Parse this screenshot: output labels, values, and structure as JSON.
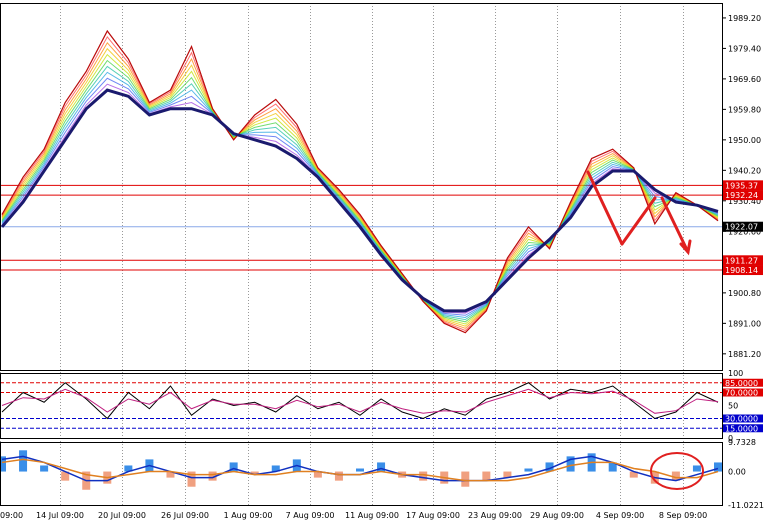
{
  "chart_data": [
    {
      "type": "line",
      "panel": "price",
      "ylim": [
        1876.0,
        1994.0
      ],
      "y_ticks": [
        "1989.20",
        "1979.40",
        "1969.60",
        "1959.80",
        "1950.00",
        "1940.20",
        "1930.40",
        "1920.60",
        "1900.80",
        "1891.00",
        "1881.20"
      ],
      "price_line_label": "1922.07",
      "price_line_value": 1922.07,
      "levels": [
        {
          "label": "1935.37",
          "value": 1935.37
        },
        {
          "label": "1932.24",
          "value": 1932.24
        },
        {
          "label": "1911.27",
          "value": 1911.27
        },
        {
          "label": "1908.14",
          "value": 1908.14
        }
      ],
      "x_labels": [
        "09:00",
        "14 Jul 09:00",
        "20 Jul 09:00",
        "26 Jul 09:00",
        "1 Aug 09:00",
        "7 Aug 09:00",
        "11 Aug 09:00",
        "17 Aug 09:00",
        "23 Aug 09:00",
        "29 Aug 09:00",
        "4 Sep 09:00",
        "8 Sep 09:00"
      ],
      "series": [
        {
          "values": [
            1926,
            1938,
            1947,
            1962,
            1972,
            1985,
            1976,
            1962,
            1966,
            1980,
            1960,
            1950,
            1958,
            1963,
            1955,
            1941,
            1934,
            1926,
            1916,
            1907,
            1898,
            1891,
            1888,
            1895,
            1912,
            1922,
            1915,
            1930,
            1944,
            1947,
            1941,
            1923,
            1933,
            1929,
            1924
          ]
        },
        {
          "values": [
            1922,
            1930,
            1940,
            1950,
            1960,
            1966,
            1964,
            1958,
            1960,
            1960,
            1958,
            1952,
            1950,
            1948,
            1944,
            1938,
            1930,
            1922,
            1913,
            1905,
            1899,
            1895,
            1895,
            1898,
            1905,
            1912,
            1918,
            1925,
            1935,
            1940,
            1940,
            1934,
            1930,
            1929,
            1927
          ]
        }
      ]
    },
    {
      "type": "line",
      "panel": "oscillator",
      "ylim": [
        0,
        100
      ],
      "y_ticks": [
        "100",
        "50",
        "0"
      ],
      "levels": [
        {
          "label": "85.0000",
          "value": 85
        },
        {
          "label": "70.0000",
          "value": 70
        },
        {
          "label": "30.0000",
          "value": 30
        },
        {
          "label": "15.0000",
          "value": 15
        }
      ],
      "series": [
        {
          "values": [
            40,
            70,
            55,
            85,
            60,
            30,
            70,
            45,
            80,
            35,
            60,
            50,
            55,
            40,
            65,
            45,
            55,
            35,
            60,
            40,
            30,
            45,
            35,
            60,
            70,
            85,
            60,
            75,
            70,
            80,
            55,
            30,
            40,
            70,
            55
          ]
        },
        {
          "values": [
            50,
            62,
            60,
            75,
            62,
            40,
            60,
            52,
            70,
            45,
            58,
            52,
            52,
            45,
            58,
            48,
            52,
            40,
            55,
            45,
            38,
            42,
            40,
            55,
            65,
            75,
            62,
            70,
            68,
            72,
            58,
            38,
            42,
            60,
            56
          ]
        }
      ]
    },
    {
      "type": "bar",
      "panel": "histogram",
      "ylim": [
        -11.0221,
        9.7328
      ],
      "y_ticks": [
        "9.7328",
        "0.00",
        "-11.0221"
      ],
      "values": [
        5,
        7,
        2,
        -3,
        -6,
        -4,
        2,
        4,
        -2,
        -5,
        -3,
        3,
        -1,
        2,
        4,
        -2,
        -3,
        1,
        3,
        -2,
        -3,
        -4,
        -5,
        -3,
        -2,
        1,
        3,
        5,
        6,
        3,
        -2,
        -4,
        -3,
        2,
        3
      ],
      "series": [
        {
          "values": [
            4,
            5,
            3,
            0,
            -3,
            -3,
            0,
            2,
            0,
            -2,
            -2,
            1,
            -1,
            0,
            2,
            0,
            -1,
            -1,
            1,
            -1,
            -2,
            -3,
            -3,
            -3,
            -2,
            -1,
            1,
            4,
            5,
            3,
            0,
            -2,
            -3,
            -1,
            1
          ]
        },
        {
          "values": [
            3,
            4,
            3,
            1,
            -1,
            -2,
            -1,
            0,
            0,
            -1,
            -1,
            0,
            -1,
            -1,
            0,
            0,
            -1,
            -1,
            0,
            -1,
            -1,
            -2,
            -3,
            -3,
            -3,
            -2,
            0,
            2,
            3,
            3,
            1,
            0,
            -2,
            -2,
            0
          ]
        }
      ]
    }
  ]
}
